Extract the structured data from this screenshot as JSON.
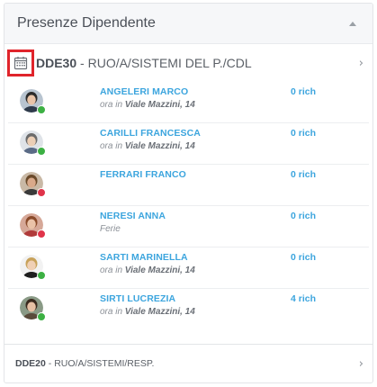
{
  "panel": {
    "title": "Presenze Dipendente"
  },
  "group_primary": {
    "code": "DDE30",
    "separator": " - ",
    "name": "RUO/A/SISTEMI DEL P./CDL"
  },
  "employees": [
    {
      "name": "ANGELERI MARCO",
      "prefix": "ora in ",
      "place": "Viale Mazzini, 14",
      "rich": "0 rich",
      "status_color": "#3cb043",
      "avatar_bg": "#b8c4d0",
      "hair": "#2b2b2b",
      "skin": "#e9c4a8",
      "shirt": "#2e3a4a"
    },
    {
      "name": "CARILLI FRANCESCA",
      "prefix": "ora in ",
      "place": "Viale Mazzini, 14",
      "rich": "0 rich",
      "status_color": "#3cb043",
      "avatar_bg": "#dfe3e8",
      "hair": "#6b6b6b",
      "skin": "#eccfb6",
      "shirt": "#5a6b86"
    },
    {
      "name": "FERRARI FRANCO",
      "prefix": "",
      "place": "",
      "rich": "0 rich",
      "status_color": "#e0344a",
      "avatar_bg": "#c9b9a6",
      "hair": "#6a4a2a",
      "skin": "#d9a98a",
      "shirt": "#3a3a3a"
    },
    {
      "name": "NERESI ANNA",
      "prefix": "",
      "place": "",
      "note": "Ferie",
      "rich": "0 rich",
      "status_color": "#e0344a",
      "avatar_bg": "#d6a898",
      "hair": "#8a4a2a",
      "skin": "#eac2a8",
      "shirt": "#b03a3a"
    },
    {
      "name": "SARTI MARINELLA",
      "prefix": "ora in ",
      "place": "Viale Mazzini, 14",
      "rich": "0 rich",
      "status_color": "#3cb043",
      "avatar_bg": "#f2f2f2",
      "hair": "#c8a25a",
      "skin": "#f0d0b5",
      "shirt": "#1e1e1e"
    },
    {
      "name": "SIRTI LUCREZIA",
      "prefix": "ora in ",
      "place": "Viale Mazzini, 14",
      "rich": "4 rich",
      "status_color": "#3cb043",
      "avatar_bg": "#8a9a86",
      "hair": "#3a2a1e",
      "skin": "#e6c0a4",
      "shirt": "#5a4a3a"
    }
  ],
  "group_secondary": {
    "code": "DDE20",
    "separator": " - ",
    "name": "RUO/A/SISTEMI/RESP."
  },
  "icons": {
    "calendar": "calendar-icon",
    "chevron": "chevron-right-icon",
    "collapse": "caret-up-icon"
  }
}
